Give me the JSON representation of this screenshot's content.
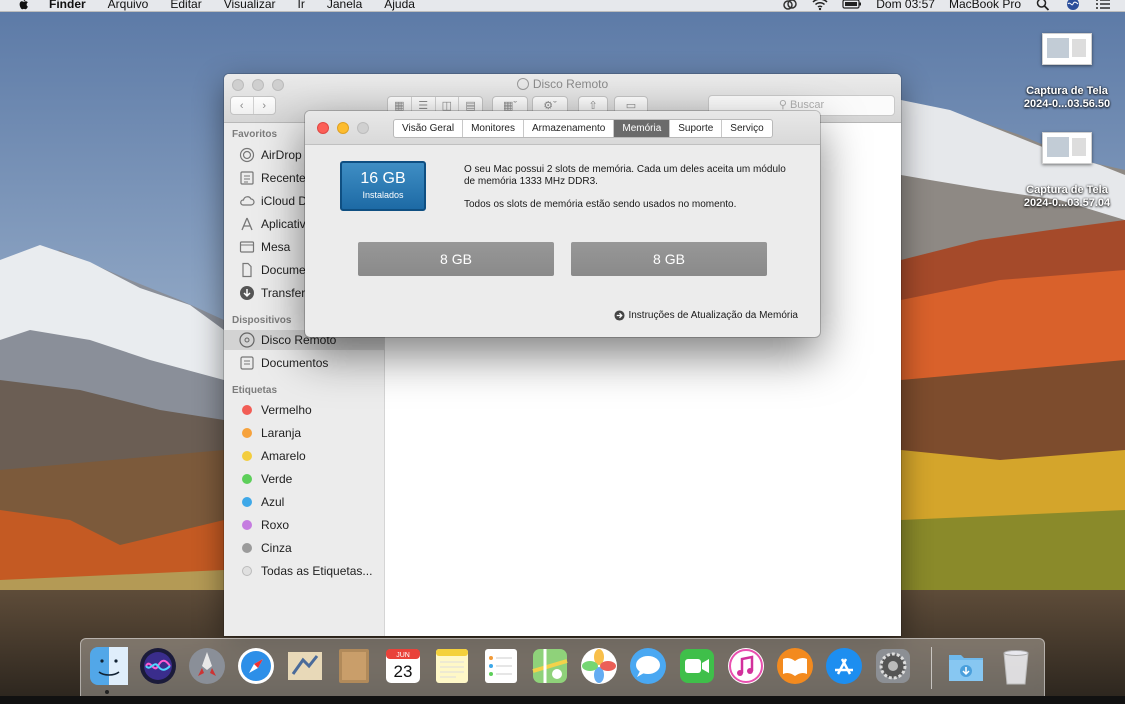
{
  "menubar": {
    "app_name": "Finder",
    "menus": [
      "Arquivo",
      "Editar",
      "Visualizar",
      "Ir",
      "Janela",
      "Ajuda"
    ],
    "clock": "Dom 03:57",
    "computer_name": "MacBook Pro",
    "icons": [
      "apple-icon",
      "creative-cloud-icon",
      "wifi-icon",
      "battery-icon",
      "spotlight-search-icon",
      "siri-icon",
      "notification-center-icon"
    ]
  },
  "desktop": {
    "files": [
      {
        "name": "Captura de Tela",
        "date": "2024-0...03.56.50"
      },
      {
        "name": "Captura de Tela",
        "date": "2024-0...03.57.04"
      }
    ]
  },
  "finder": {
    "title": "Disco Remoto",
    "search_placeholder": "Buscar",
    "sidebar": {
      "favorites_header": "Favoritos",
      "favorites": [
        {
          "label": "AirDrop",
          "icon": "airdrop-icon"
        },
        {
          "label": "Recentes",
          "icon": "recents-icon"
        },
        {
          "label": "iCloud Drive",
          "icon": "icloud-icon"
        },
        {
          "label": "Aplicativos",
          "icon": "applications-icon"
        },
        {
          "label": "Mesa",
          "icon": "desktop-icon"
        },
        {
          "label": "Documentos",
          "icon": "documents-icon"
        },
        {
          "label": "Transferências",
          "icon": "downloads-icon"
        }
      ],
      "devices_header": "Dispositivos",
      "devices": [
        {
          "label": "Disco Remoto",
          "icon": "remote-disc-icon",
          "selected": true
        },
        {
          "label": "Documentos",
          "icon": "documents-icon"
        }
      ],
      "tags_header": "Etiquetas",
      "tags": [
        {
          "label": "Vermelho",
          "color": "#f25d55"
        },
        {
          "label": "Laranja",
          "color": "#f6a23c"
        },
        {
          "label": "Amarelo",
          "color": "#f3cd3e"
        },
        {
          "label": "Verde",
          "color": "#5dcf5a"
        },
        {
          "label": "Azul",
          "color": "#3ea8e8"
        },
        {
          "label": "Roxo",
          "color": "#c57ce0"
        },
        {
          "label": "Cinza",
          "color": "#9b9b9b"
        },
        {
          "label": "Todas as Etiquetas...",
          "color": "#e0e0e0"
        }
      ]
    }
  },
  "about": {
    "tabs": [
      "Visão Geral",
      "Monitores",
      "Armazenamento",
      "Memória",
      "Suporte",
      "Serviço"
    ],
    "active_tab": "Memória",
    "memory_total": "16 GB",
    "memory_caption": "Instalados",
    "description_line1": "O seu Mac possui 2 slots de memória. Cada um deles aceita um módulo",
    "description_line2": "de memória 1333 MHz DDR3.",
    "slots_status": "Todos os slots de memória estão sendo usados no momento.",
    "slots": [
      "8 GB",
      "8 GB"
    ],
    "upgrade_link": "Instruções de Atualização da Memória"
  },
  "dock": {
    "apps": [
      "finder-icon",
      "siri-icon",
      "launchpad-icon",
      "safari-icon",
      "mail-icon",
      "contacts-icon",
      "calendar-icon",
      "notes-icon",
      "reminders-icon",
      "maps-icon",
      "photos-icon",
      "messages-icon",
      "facetime-icon",
      "itunes-icon",
      "ibooks-icon",
      "app-store-icon",
      "system-preferences-icon"
    ],
    "calendar_month": "JUN",
    "calendar_day": "23",
    "extras": [
      "downloads-folder-icon",
      "trash-icon"
    ]
  },
  "colors": {
    "accent_blue": "#1d6aa5",
    "active_tab": "#6b6b6b",
    "close_red": "#fc5f57",
    "minimize_yellow": "#fdbc2e"
  }
}
